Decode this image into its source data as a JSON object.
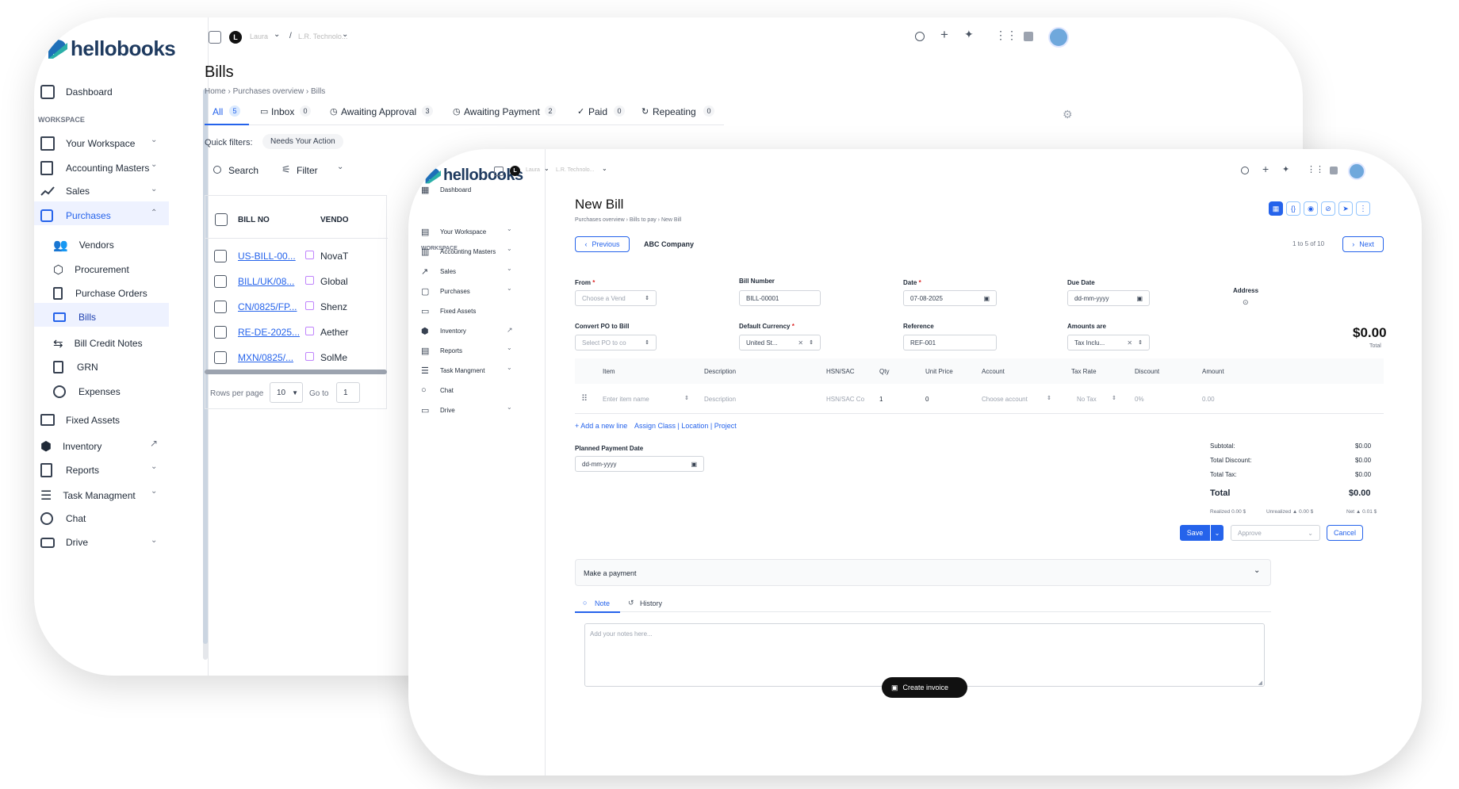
{
  "back": {
    "logo": "hellobooks",
    "workspace_label": "WORKSPACE",
    "nav": [
      {
        "label": "Dashboard",
        "icon": "dashboard-icon"
      },
      {
        "label": "Your Workspace",
        "icon": "workspace-icon"
      },
      {
        "label": "Accounting Masters",
        "icon": "ledger-icon"
      },
      {
        "label": "Sales",
        "icon": "trend-icon"
      },
      {
        "label": "Purchases",
        "icon": "cart-icon"
      },
      {
        "label": "Vendors",
        "icon": "users-icon"
      },
      {
        "label": "Procurement",
        "icon": "box-icon"
      },
      {
        "label": "Purchase Orders",
        "icon": "doc-icon"
      },
      {
        "label": "Bills",
        "icon": "card-icon"
      },
      {
        "label": "Bill Credit Notes",
        "icon": "swap-icon"
      },
      {
        "label": "GRN",
        "icon": "clipboard-icon"
      },
      {
        "label": "Expenses",
        "icon": "clock-icon"
      },
      {
        "label": "Fixed Assets",
        "icon": "archive-icon"
      },
      {
        "label": "Inventory",
        "icon": "inventory-icon"
      },
      {
        "label": "Reports",
        "icon": "report-icon"
      },
      {
        "label": "Task Managment",
        "icon": "tasks-icon"
      },
      {
        "label": "Chat",
        "icon": "chat-icon"
      },
      {
        "label": "Drive",
        "icon": "drive-icon"
      }
    ],
    "topbar": {
      "org_initial": "L",
      "org": "Laura",
      "sep": "/",
      "company": "L.R. Technolo..."
    },
    "title": "Bills",
    "breadcrumb": [
      "Home",
      "Purchases overview",
      "Bills"
    ],
    "tabs": [
      {
        "label": "All",
        "count": "5"
      },
      {
        "label": "Inbox",
        "count": "0"
      },
      {
        "label": "Awaiting Approval",
        "count": "3"
      },
      {
        "label": "Awaiting Payment",
        "count": "2"
      },
      {
        "label": "Paid",
        "count": "0"
      },
      {
        "label": "Repeating",
        "count": "0"
      }
    ],
    "quick_filters_label": "Quick filters:",
    "quick_filter": "Needs Your Action",
    "search": "Search",
    "filter": "Filter",
    "table_headers": [
      "BILL NO",
      "VENDO"
    ],
    "rows": [
      {
        "bill": "US-BILL-00...",
        "vendor": "NovaT"
      },
      {
        "bill": "BILL/UK/08...",
        "vendor": "Global"
      },
      {
        "bill": "CN/0825/FP...",
        "vendor": "Shenz"
      },
      {
        "bill": "RE-DE-2025...",
        "vendor": "Aether"
      },
      {
        "bill": "MXN/0825/...",
        "vendor": "SolMe"
      }
    ],
    "rows_per_page_label": "Rows per page",
    "rows_per_page": "10",
    "goto_label": "Go to",
    "goto": "1"
  },
  "front": {
    "logo": "hellobooks",
    "workspace_label": "WORKSPACE",
    "nav": [
      {
        "label": "Dashboard"
      },
      {
        "label": "Your Workspace"
      },
      {
        "label": "Accounting Masters"
      },
      {
        "label": "Sales"
      },
      {
        "label": "Purchases"
      },
      {
        "label": "Fixed Assets"
      },
      {
        "label": "Inventory"
      },
      {
        "label": "Reports"
      },
      {
        "label": "Task Mangment"
      },
      {
        "label": "Chat"
      },
      {
        "label": "Drive"
      }
    ],
    "topbar": {
      "org_initial": "L",
      "org": "Laura",
      "company": "L.R. Technolo..."
    },
    "title": "New Bill",
    "breadcrumb": [
      "Purchases overview",
      "Bills to pay",
      "New Bill"
    ],
    "previous": "Previous",
    "company": "ABC Company",
    "pager": "1 to 5 of 10",
    "next": "Next",
    "from_label": "From",
    "from_ph": "Choose a Vend",
    "bill_number_label": "Bill Number",
    "bill_number": "BILL-00001",
    "date_label": "Date",
    "date": "07-08-2025",
    "due_label": "Due Date",
    "due": "dd-mm-yyyy",
    "address_label": "Address",
    "po_label": "Convert PO to Bill",
    "po_ph": "Select PO to co",
    "currency_label": "Default Currency",
    "currency": "United St...",
    "reference_label": "Reference",
    "reference": "REF-001",
    "amounts_label": "Amounts are",
    "amounts": "Tax Inclu...",
    "total_big": "$0.00",
    "total_caption": "Total",
    "line_headers": [
      "Item",
      "Description",
      "HSN/SAC",
      "Qty",
      "Unit Price",
      "Account",
      "Tax Rate",
      "Discount",
      "Amount"
    ],
    "line": {
      "item": "Enter item name",
      "desc": "Description",
      "hsn": "HSN/SAC Co",
      "qty": "1",
      "price": "0",
      "account": "Choose account",
      "tax": "No Tax",
      "disc": "0%",
      "amount": "0.00"
    },
    "add_line": "+ Add a new line",
    "assign": "Assign Class | Location | Project",
    "planned_label": "Planned Payment Date",
    "planned": "dd-mm-yyyy",
    "summary": [
      {
        "label": "Subtotal:",
        "value": "$0.00"
      },
      {
        "label": "Total Discount:",
        "value": "$0.00"
      },
      {
        "label": "Total Tax:",
        "value": "$0.00"
      }
    ],
    "total_label": "Total",
    "total_value": "$0.00",
    "realized": "Realized 0.00 $",
    "unrealized": "Unrealized ▲ 0.00 $",
    "net": "Net ▲ 0.01 $",
    "save": "Save",
    "approve": "Approve",
    "cancel": "Cancel",
    "make_payment": "Make a payment",
    "note_tab": "Note",
    "history_tab": "History",
    "notes_ph": "Add your notes here...",
    "create_invoice": "Create invoice"
  },
  "colors": {
    "accent": "#2563eb",
    "logo": "#1e6fb8",
    "active_bg": "#eef2ff"
  }
}
